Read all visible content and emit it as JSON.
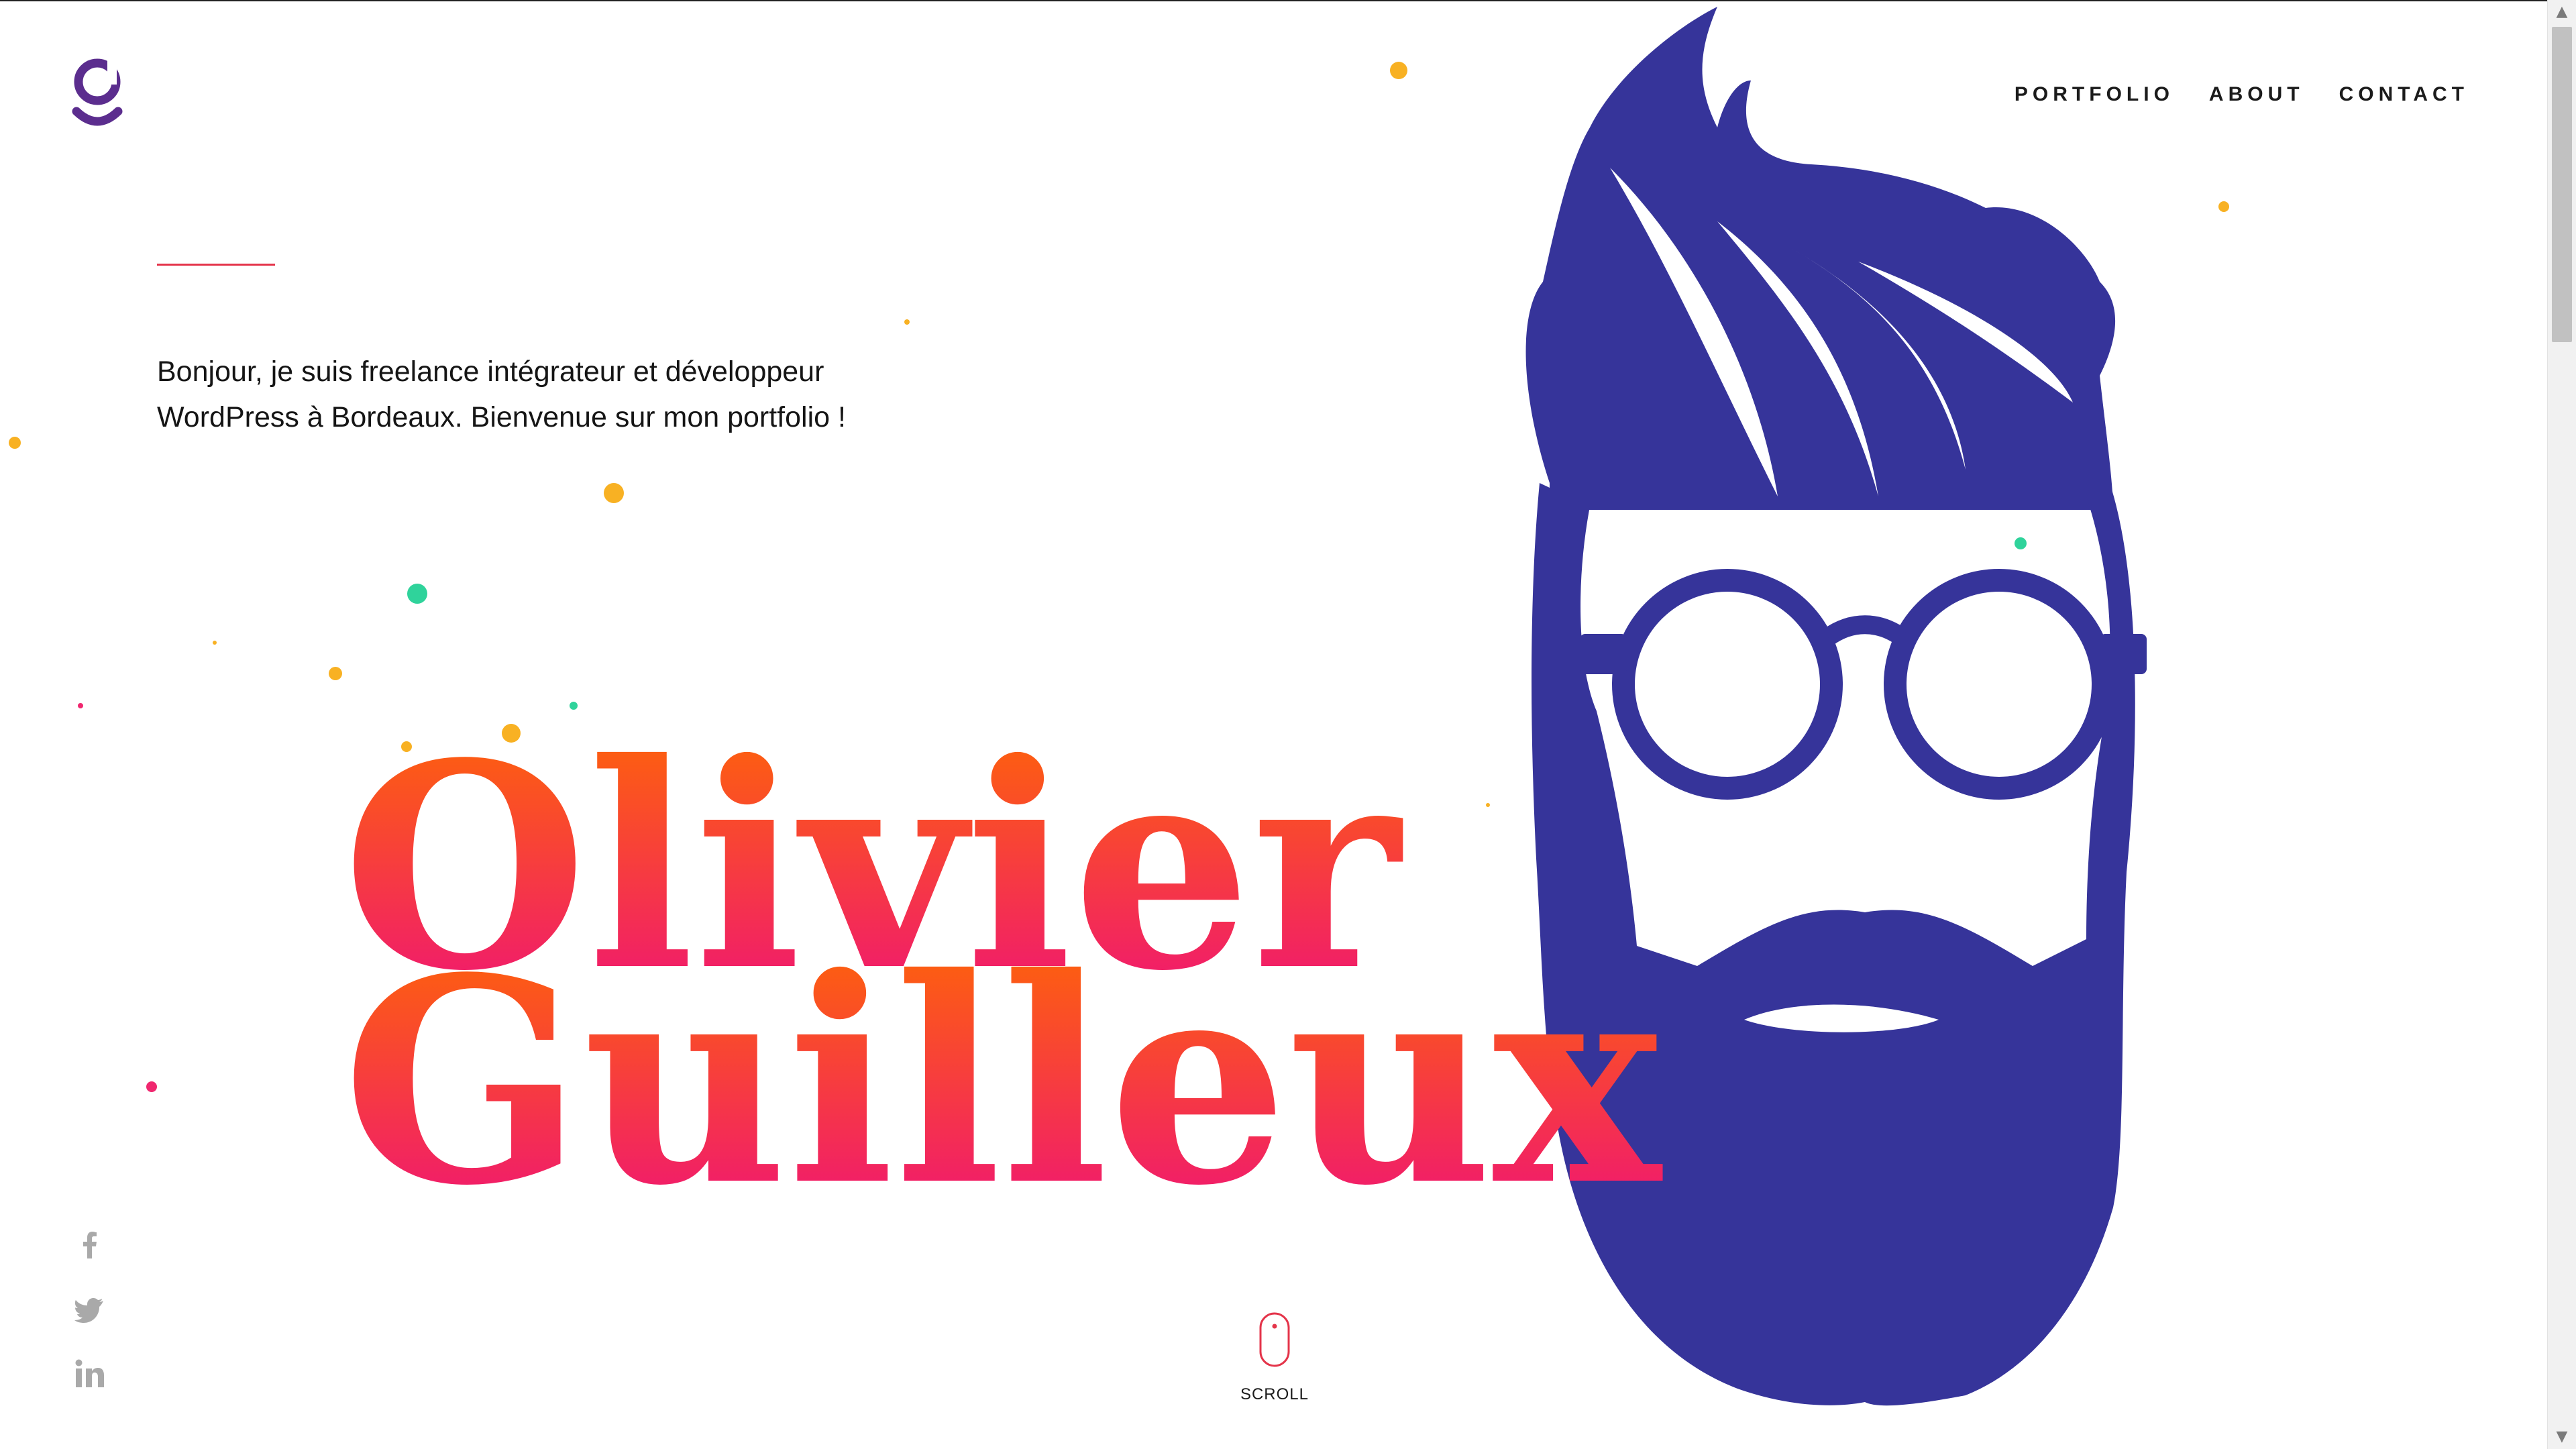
{
  "nav": {
    "items": [
      {
        "label": "PORTFOLIO"
      },
      {
        "label": "ABOUT"
      },
      {
        "label": "CONTACT"
      }
    ]
  },
  "intro": {
    "line1": "Bonjour, je suis freelance intégrateur et développeur",
    "line2": "WordPress à Bordeaux. Bienvenue sur mon portfolio !"
  },
  "hero": {
    "first_name": "Olivier",
    "last_name": "Guilleux"
  },
  "social": [
    "facebook-icon",
    "twitter-icon",
    "linkedin-icon"
  ],
  "scroll": {
    "label": "SCROLL"
  },
  "colors": {
    "accent_red": "#e4344a",
    "face_indigo": "#36349a",
    "logo_purple": "#5b2d8e",
    "gradient_top": "#ff6a00",
    "gradient_bottom": "#ee0e7e",
    "dot_yellow": "#f8b123",
    "dot_green": "#2fd39b",
    "dot_pink": "#f0276f",
    "social_gray": "#a9a9a9"
  }
}
